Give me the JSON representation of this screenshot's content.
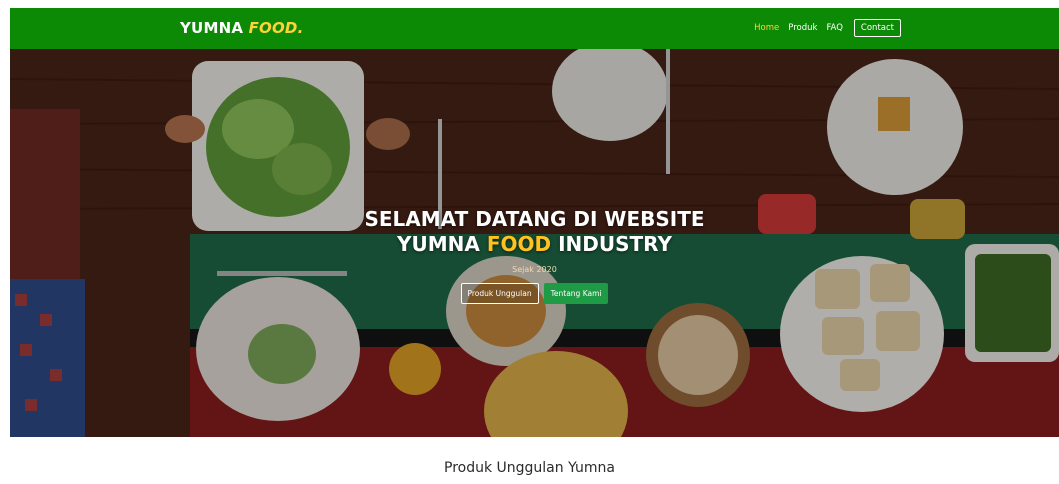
{
  "navbar": {
    "brand_main": "YUMNA",
    "brand_accent": "FOOD.",
    "links": [
      {
        "label": "Home"
      },
      {
        "label": "Produk"
      },
      {
        "label": "FAQ"
      },
      {
        "label": "Contact"
      }
    ]
  },
  "hero": {
    "title_line1": "SELAMAT DATANG DI WEBSITE",
    "title_line2_pre": "YUMNA",
    "title_line2_accent": "FOOD",
    "title_line2_post": "INDUSTRY",
    "subtitle": "Sejak 2020",
    "primary_button": "Produk Unggulan",
    "secondary_button": "Tentang Kami"
  },
  "section": {
    "title": "Produk Unggulan Yumna"
  },
  "colors": {
    "navbar_bg": "#0c8a06",
    "brand_accent": "#ffd336",
    "hero_accent": "#ffc21f",
    "button_green": "#1f9a45"
  }
}
